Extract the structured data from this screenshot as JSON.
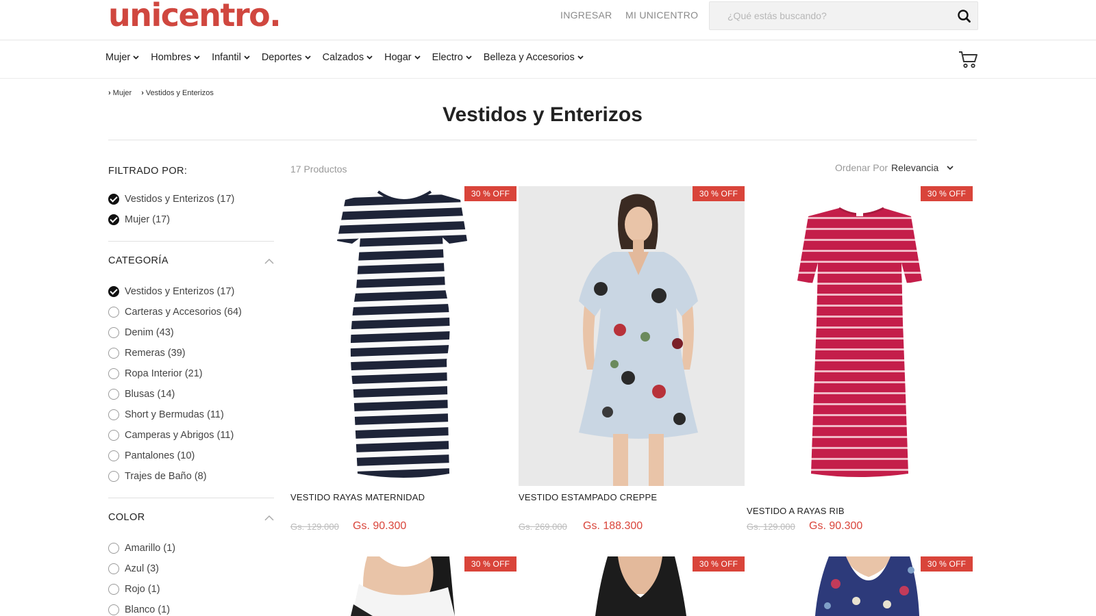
{
  "header": {
    "logo": "unicentro.",
    "login": "INGRESAR",
    "my_account": "MI UNICENTRO",
    "search_placeholder": "¿Qué estás buscando?"
  },
  "nav": {
    "items": [
      "Mujer",
      "Hombres",
      "Infantil",
      "Deportes",
      "Calzados",
      "Hogar",
      "Electro",
      "Belleza y Accesorios"
    ]
  },
  "breadcrumb": [
    "Mujer",
    "Vestidos y Enterizos"
  ],
  "page_title": "Vestidos y Enterizos",
  "sidebar": {
    "filtered_by_heading": "FILTRADO POR:",
    "active_filters": [
      "Vestidos y Enterizos (17)",
      "Mujer (17)"
    ],
    "category": {
      "heading": "CATEGORÍA",
      "options": [
        {
          "label": "Vestidos y Enterizos (17)",
          "checked": true
        },
        {
          "label": "Carteras y Accesorios (64)",
          "checked": false
        },
        {
          "label": "Denim (43)",
          "checked": false
        },
        {
          "label": "Remeras (39)",
          "checked": false
        },
        {
          "label": "Ropa Interior (21)",
          "checked": false
        },
        {
          "label": "Blusas (14)",
          "checked": false
        },
        {
          "label": "Short y Bermudas (11)",
          "checked": false
        },
        {
          "label": "Camperas y Abrigos (11)",
          "checked": false
        },
        {
          "label": "Pantalones (10)",
          "checked": false
        },
        {
          "label": "Trajes de Baño (8)",
          "checked": false
        }
      ]
    },
    "color": {
      "heading": "COLOR",
      "options": [
        {
          "label": "Amarillo (1)",
          "checked": false
        },
        {
          "label": "Azul (3)",
          "checked": false
        },
        {
          "label": "Rojo (1)",
          "checked": false
        },
        {
          "label": "Blanco (1)",
          "checked": false
        }
      ]
    }
  },
  "listing": {
    "count": "17 Productos",
    "sort_label": "Ordenar Por",
    "sort_value": "Relevancia"
  },
  "products": [
    {
      "name": "VESTIDO RAYAS MATERNIDAD",
      "old_price": "Gs. 129.000",
      "price": "Gs. 90.300",
      "badge": "30 % OFF",
      "image": "navy-striped-maternity-dress"
    },
    {
      "name": "VESTIDO ESTAMPADO CREPPE",
      "old_price": "Gs. 269.000",
      "price": "Gs. 188.300",
      "badge": "30 % OFF",
      "image": "floral-print-dress-model"
    },
    {
      "name": "VESTIDO A RAYAS RIB",
      "old_price": "Gs. 129.000",
      "price": "Gs. 90.300",
      "badge": "30 % OFF",
      "image": "red-striped-rib-dress"
    },
    {
      "badge": "30 % OFF",
      "image": "model-white-top"
    },
    {
      "badge": "30 % OFF",
      "image": "model-black-top"
    },
    {
      "badge": "30 % OFF",
      "image": "model-floral-top"
    }
  ],
  "colors": {
    "brand": "#d0473f",
    "discount": "#d9443a",
    "text": "#222222",
    "muted": "#999999"
  }
}
